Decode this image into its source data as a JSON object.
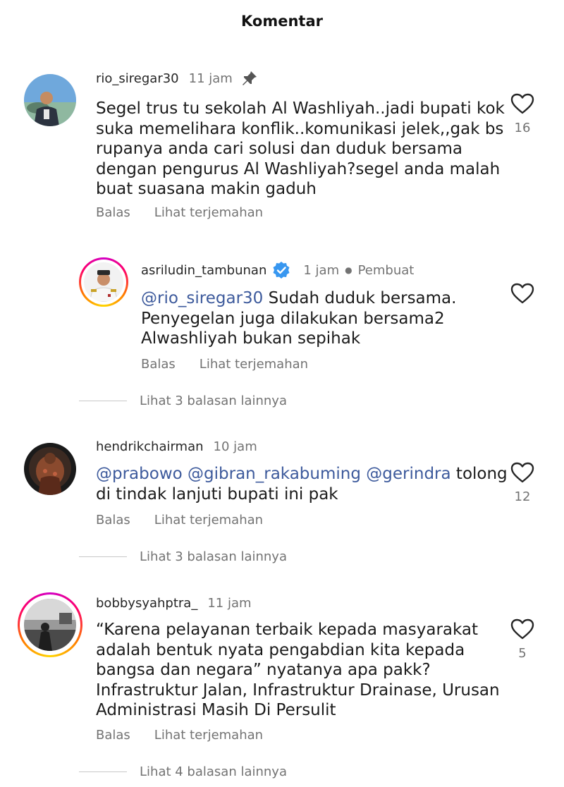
{
  "header": {
    "title": "Komentar"
  },
  "comments": [
    {
      "username": "rio_siregar30",
      "time": "11 jam",
      "pinned": true,
      "text": "Segel trus tu sekolah Al Washliyah..jadi bupati kok\nsuka memelihara konflik..komunikasi jelek,,gak bs\nrupanya anda cari solusi dan duduk bersama\ndengan pengurus Al Washliyah?segel anda malah\nbuat suasana makin gaduh",
      "likes": "16",
      "reply_label": "Balas",
      "translate_label": "Lihat terjemahan"
    },
    {
      "username": "asriludin_tambunan",
      "verified": true,
      "time": "1 jam",
      "role": "Pembuat",
      "mention": "@rio_siregar30",
      "text": " Sudah duduk bersama.\nPenyegelan juga dilakukan bersama2\nAlwashliyah bukan sepihak",
      "reply_label": "Balas",
      "translate_label": "Lihat terjemahan",
      "more_replies": "Lihat 3 balasan lainnya"
    },
    {
      "username": "hendrikchairman",
      "time": "10 jam",
      "mentions": [
        "@prabowo",
        "@gibran_rakabuming",
        "@gerindra"
      ],
      "text_after": " tolong\ndi tindak lanjuti bupati ini pak",
      "likes": "12",
      "reply_label": "Balas",
      "translate_label": "Lihat terjemahan",
      "more_replies": "Lihat 3 balasan lainnya"
    },
    {
      "username": "bobbysyahptra_",
      "time": "11 jam",
      "text": "“Karena pelayanan terbaik kepada masyarakat\nadalah bentuk nyata pengabdian kita kepada\nbangsa dan negara” nyatanya apa pakk?\nInfrastruktur Jalan, Infrastruktur Drainase, Urusan\nAdministrasi Masih Di Persulit",
      "likes": "5",
      "reply_label": "Balas",
      "translate_label": "Lihat terjemahan",
      "more_replies": "Lihat 4 balasan lainnya"
    }
  ],
  "colors": {
    "mention": "#3d5a9c",
    "verified": "#3897f0",
    "muted": "#737373"
  },
  "icons": {
    "pin": "pin-icon",
    "like": "heart-outline-icon",
    "verified": "verified-badge-icon"
  }
}
